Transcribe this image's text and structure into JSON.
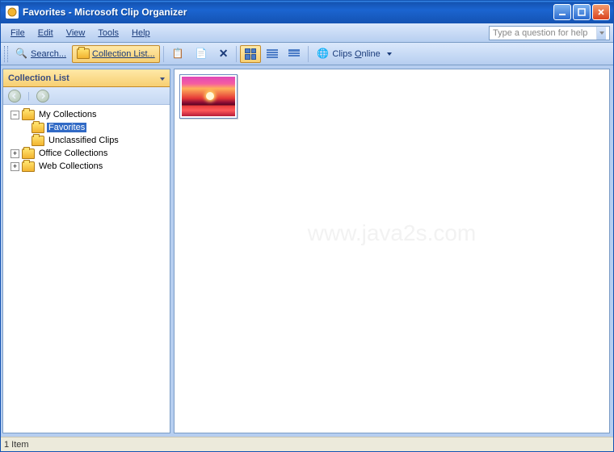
{
  "window": {
    "title": "Favorites - Microsoft Clip Organizer"
  },
  "menus": {
    "file": "File",
    "edit": "Edit",
    "view": "View",
    "tools": "Tools",
    "help": "Help"
  },
  "help_placeholder": "Type a question for help",
  "toolbar": {
    "search": "Search...",
    "collection_list": "Collection List...",
    "clips_online": "Clips Online"
  },
  "pane": {
    "title": "Collection List"
  },
  "tree": {
    "root": "My Collections",
    "favorites": "Favorites",
    "unclassified": "Unclassified Clips",
    "office": "Office Collections",
    "web": "Web Collections"
  },
  "watermark": "www.java2s.com",
  "status": "1 Item"
}
